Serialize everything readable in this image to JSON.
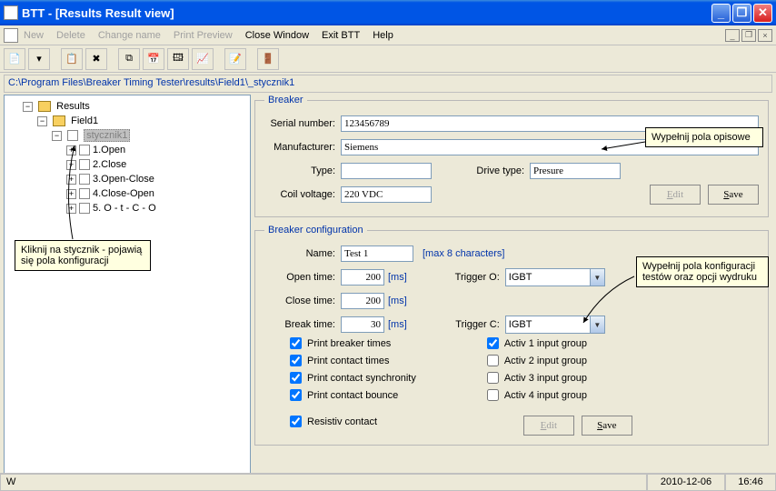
{
  "title": "BTT - [Results       Result view]",
  "menu": {
    "new": "New",
    "delete": "Delete",
    "change": "Change name",
    "preview": "Print Preview",
    "close": "Close Window",
    "exit": "Exit BTT",
    "help": "Help"
  },
  "path": "C:\\Program Files\\Breaker Timing Tester\\results\\Field1\\_stycznik1",
  "tree": {
    "root": "Results",
    "field": "Field1",
    "stycznik": "stycznik1",
    "items": [
      "1.Open",
      "2.Close",
      "3.Open-Close",
      "4.Close-Open",
      "5. O - t - C - O"
    ]
  },
  "breaker": {
    "legend": "Breaker",
    "serial_lbl": "Serial number:",
    "serial": "123456789",
    "manu_lbl": "Manufacturer:",
    "manu": "Siemens",
    "type_lbl": "Type:",
    "type": "",
    "drive_lbl": "Drive type:",
    "drive": "Presure",
    "coil_lbl": "Coil voltage:",
    "coil": "220 VDC",
    "edit": "Edit",
    "save": "Save"
  },
  "config": {
    "legend": "Breaker configuration",
    "name_lbl": "Name:",
    "name": "Test 1",
    "name_hint": "[max 8 characters]",
    "open_lbl": "Open time:",
    "open": "200",
    "ms": "[ms]",
    "trigo_lbl": "Trigger O:",
    "trigo": "IGBT",
    "close_lbl": "Close time:",
    "close": "200",
    "break_lbl": "Break time:",
    "break": "30",
    "trigc_lbl": "Trigger C:",
    "trigc": "IGBT",
    "c1": "Print breaker times",
    "c2": "Print contact times",
    "c3": "Print contact synchronity",
    "c4": "Print contact bounce",
    "c5": "Resistiv contact",
    "a1": "Activ 1 input group",
    "a2": "Activ 2 input group",
    "a3": "Activ 3 input group",
    "a4": "Activ 4 input group",
    "edit": "Edit",
    "save": "Save"
  },
  "callouts": {
    "c0": "Kliknij na stycznik - pojawią się pola konfiguracji",
    "c1": "Wypełnij pola opisowe",
    "c2": "Wypełnij pola konfiguracji testów oraz opcji wydruku"
  },
  "status": {
    "w": "W",
    "date": "2010-12-06",
    "time": "16:46"
  }
}
